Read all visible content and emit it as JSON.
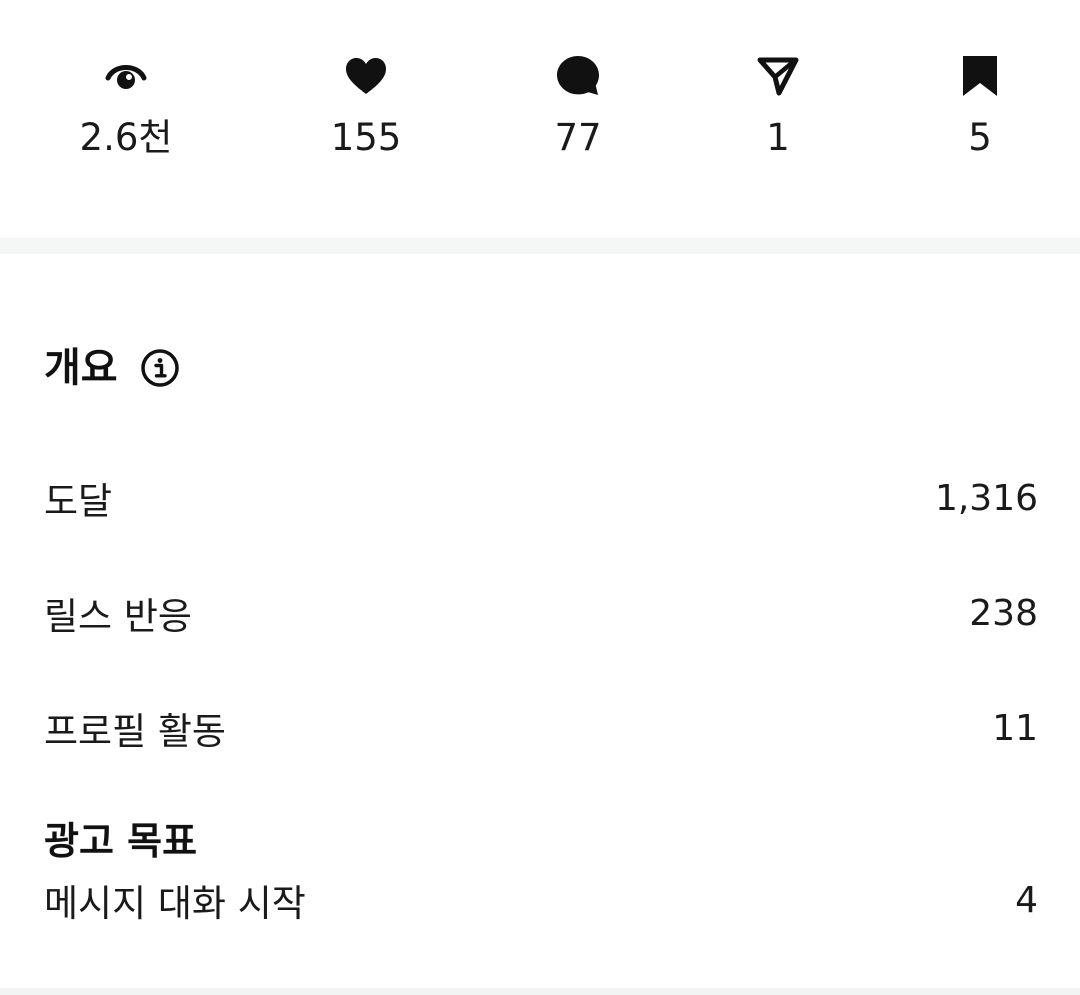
{
  "engagement_stats": [
    {
      "icon": "eye-icon",
      "count": "2.6천"
    },
    {
      "icon": "heart-icon",
      "count": "155"
    },
    {
      "icon": "comment-icon",
      "count": "77"
    },
    {
      "icon": "share-icon",
      "count": "1"
    },
    {
      "icon": "bookmark-icon",
      "count": "5"
    }
  ],
  "overview": {
    "title": "개요",
    "info_icon": "info-icon",
    "metrics": [
      {
        "label": "도달",
        "value": "1,316"
      },
      {
        "label": "릴스 반응",
        "value": "238"
      },
      {
        "label": "프로필 활동",
        "value": "11"
      }
    ]
  },
  "ad_goal": {
    "heading": "광고 목표",
    "label": "메시지 대화 시작",
    "value": "4"
  },
  "colors": {
    "text": "#111111",
    "divider": "#f5f6f6"
  }
}
